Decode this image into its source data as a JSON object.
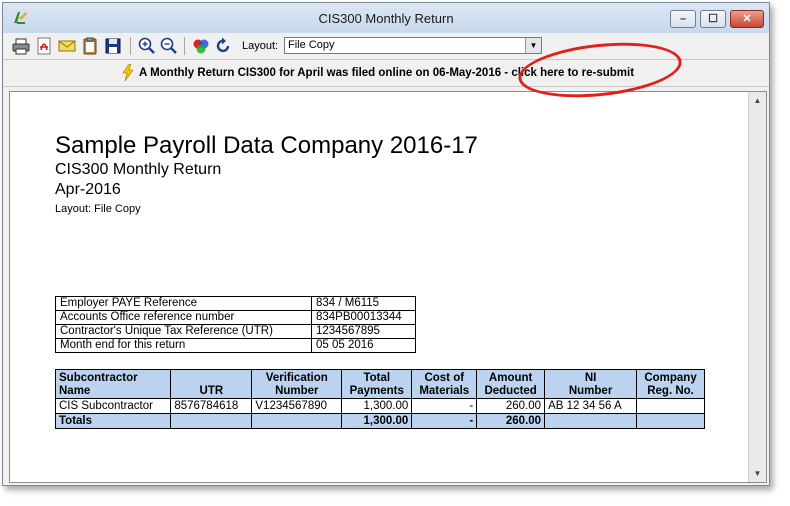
{
  "window": {
    "title": "CIS300 Monthly Return",
    "controls": {
      "minimize_glyph": "–",
      "maximize_glyph": "☐",
      "close_glyph": "✕"
    }
  },
  "toolbar": {
    "buttons": [
      {
        "name": "print-icon"
      },
      {
        "name": "pdf-icon"
      },
      {
        "name": "email-icon"
      },
      {
        "name": "clipboard-icon"
      },
      {
        "name": "save-icon"
      },
      {
        "name": "zoom-in-icon"
      },
      {
        "name": "zoom-out-icon"
      },
      {
        "name": "color-icon"
      },
      {
        "name": "refresh-icon"
      }
    ],
    "layout_label": "Layout:",
    "layout_value": "File Copy"
  },
  "notice": {
    "text": "A Monthly Return CIS300 for April was filed online on 06-May-2016 - click here to re-submit",
    "highlight_color": "#e0201a"
  },
  "document": {
    "company": "Sample Payroll Data Company 2016-17",
    "report": "CIS300 Monthly Return",
    "period": "Apr-2016",
    "layout_note": "Layout: File Copy",
    "info": [
      {
        "label": "Employer PAYE Reference",
        "value": "834 / M6115"
      },
      {
        "label": "Accounts Office reference number",
        "value": "834PB00013344"
      },
      {
        "label": "Contractor's Unique Tax Reference (UTR)",
        "value": "1234567895"
      },
      {
        "label": "Month end for this return",
        "value": "05 05 2016"
      }
    ],
    "table": {
      "headers": [
        {
          "l1": "Subcontractor",
          "l2": "Name"
        },
        {
          "l1": "",
          "l2": "UTR"
        },
        {
          "l1": "Verification",
          "l2": "Number"
        },
        {
          "l1": "Total",
          "l2": "Payments"
        },
        {
          "l1": "Cost of",
          "l2": "Materials"
        },
        {
          "l1": "Amount",
          "l2": "Deducted"
        },
        {
          "l1": "NI",
          "l2": "Number"
        },
        {
          "l1": "Company",
          "l2": "Reg. No."
        }
      ],
      "rows": [
        [
          "CIS Subcontractor",
          "8576784618",
          "V1234567890",
          "1,300.00",
          "-",
          "260.00",
          "AB 12 34 56 A",
          ""
        ]
      ],
      "totals": [
        "Totals",
        "",
        "",
        "1,300.00",
        "-",
        "260.00",
        "",
        ""
      ],
      "header_color": "#bcd3f0"
    }
  }
}
